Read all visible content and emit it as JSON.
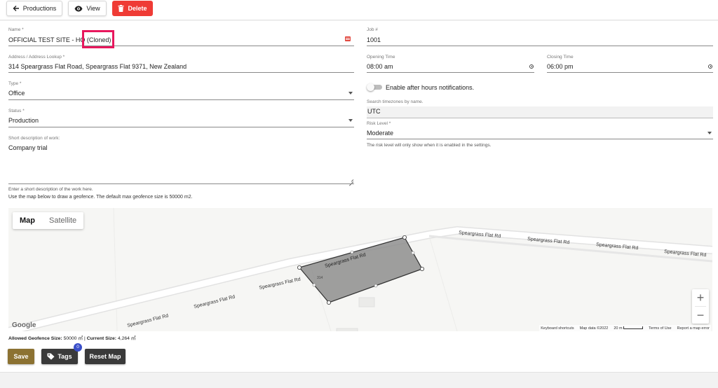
{
  "toolbar": {
    "back_label": "Productions",
    "view_label": "View",
    "delete_label": "Delete"
  },
  "form": {
    "name": {
      "label": "Name *",
      "value": "OFFICIAL TEST SITE - HQ (Cloned)"
    },
    "address": {
      "label": "Address / Address Lookup *",
      "value": "314 Speargrass Flat Road, Speargrass Flat 9371, New Zealand"
    },
    "type": {
      "label": "Type *",
      "value": "Office"
    },
    "status": {
      "label": "Status *",
      "value": "Production"
    },
    "description": {
      "label": "Short description of work:",
      "value": "Company trial",
      "hint": "Enter a short description of the work here."
    },
    "job": {
      "label": "Job #",
      "value": "1001"
    },
    "opening_time": {
      "label": "Opening Time",
      "value": "08:00 am"
    },
    "closing_time": {
      "label": "Closing Time",
      "value": "06:00 pm"
    },
    "after_hours": {
      "label": "Enable after hours notifications.",
      "enabled": false
    },
    "timezone": {
      "label": "Search timezones by name.",
      "value": "UTC"
    },
    "risk": {
      "label": "Risk Level *",
      "value": "Moderate",
      "hint": "The risk level will only show when it is enabled in the settings."
    }
  },
  "map": {
    "instruction": "Use the map below to draw a geofence. The default max geofence size is 50000 m2.",
    "type_map": "Map",
    "type_satellite": "Satellite",
    "road_label": "Speargrass Flat Rd",
    "parcel_label": "314",
    "zoom_in": "+",
    "zoom_out": "−",
    "logo": "Google",
    "attrib_shortcuts": "Keyboard shortcuts",
    "attrib_data": "Map data ©2022",
    "attrib_scale": "20 m",
    "attrib_terms": "Terms of Use",
    "attrib_report": "Report a map error",
    "geofence_allowed_label": "Allowed Geofence Size:",
    "geofence_allowed_value": "50000 ㎡",
    "geofence_current_label": "Current Size:",
    "geofence_current_value": "4,264 ㎡"
  },
  "actions": {
    "save_label": "Save",
    "tags_label": "Tags",
    "tags_count": "0",
    "reset_label": "Reset Map"
  },
  "colors": {
    "danger": "#ef3b35",
    "save": "#8c7232",
    "dark_button": "#3a3a3a",
    "highlight": "#e8175d",
    "badge": "#3a4fc9"
  }
}
